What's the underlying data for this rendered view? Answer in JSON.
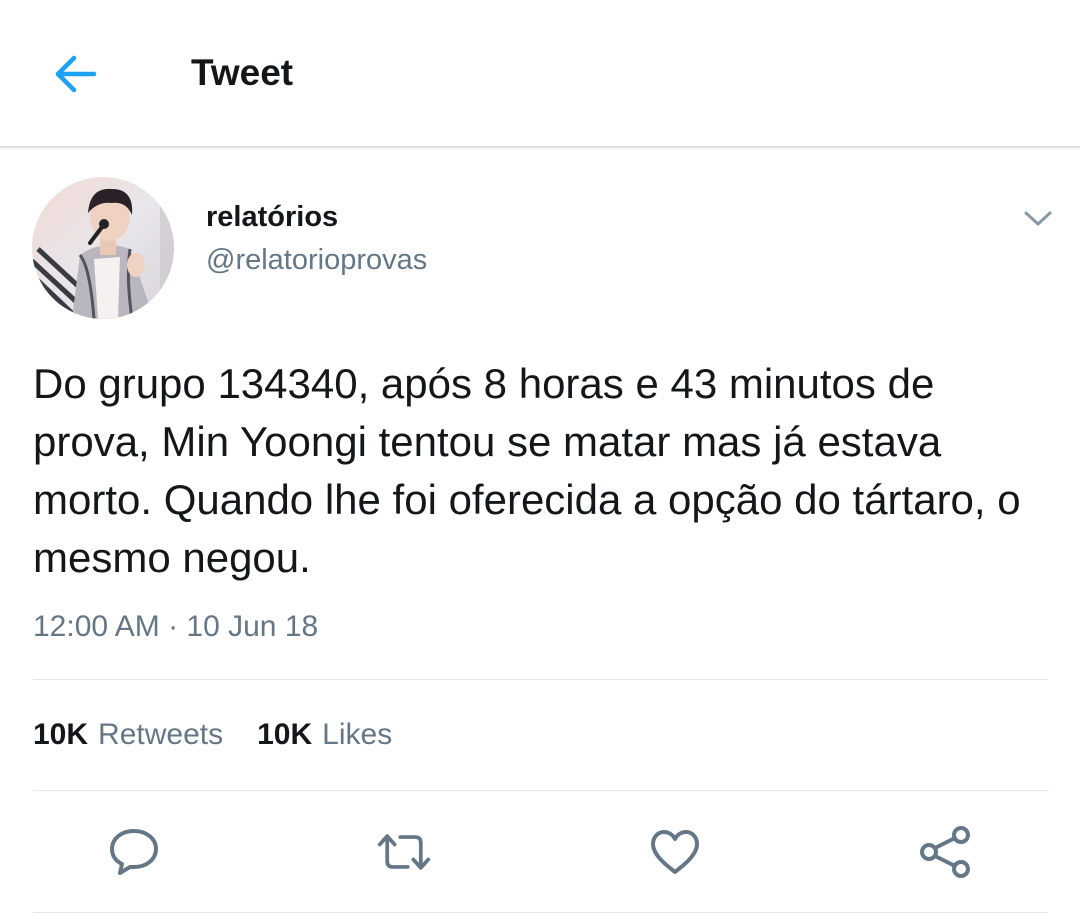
{
  "header": {
    "title": "Tweet",
    "back_icon": "arrow-left-icon",
    "accent_color": "#1da1f2"
  },
  "tweet": {
    "author": {
      "display_name": "relatórios",
      "handle": "@relatorioprovas",
      "avatar_icon": "profile-photo"
    },
    "text": "Do grupo 134340, após 8 horas e 43 minutos de prova, Min Yoongi tentou se matar mas já estava morto. Quando lhe foi oferecida a opção do tártaro, o mesmo negou.",
    "timestamp": "12:00 AM · 10 Jun 18",
    "stats": {
      "retweets_count": "10K",
      "retweets_label": "Retweets",
      "likes_count": "10K",
      "likes_label": "Likes"
    },
    "actions": [
      {
        "name": "reply",
        "icon": "speech-bubble-icon"
      },
      {
        "name": "retweet",
        "icon": "retweet-icon"
      },
      {
        "name": "like",
        "icon": "heart-icon"
      },
      {
        "name": "share",
        "icon": "share-icon"
      }
    ]
  },
  "colors": {
    "text_primary": "#14171a",
    "text_secondary": "#657786",
    "divider": "#e1e8ed",
    "icon_gray": "#657786"
  }
}
